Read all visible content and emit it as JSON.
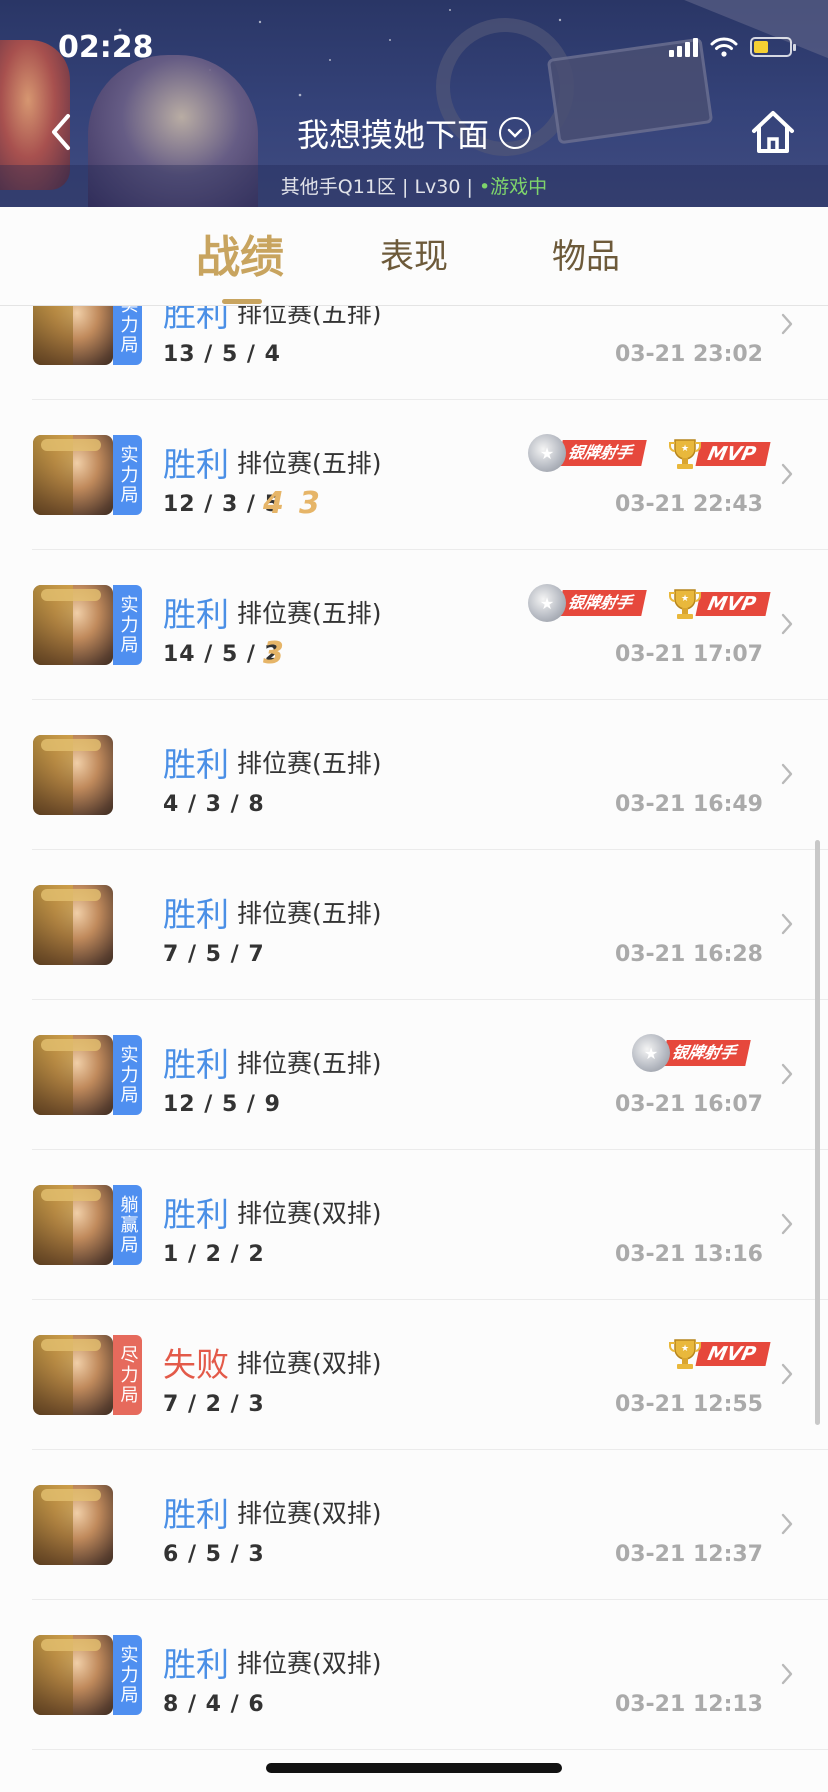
{
  "status": {
    "time": "02:28"
  },
  "header": {
    "nickname": "我想摸她下面",
    "server": "其他手Q11区",
    "level": "Lv30",
    "online_status": "游戏中"
  },
  "tabs": [
    {
      "label": "战绩",
      "active": true
    },
    {
      "label": "表现",
      "active": false
    },
    {
      "label": "物品",
      "active": false
    }
  ],
  "matches": [
    {
      "tag": "实力局",
      "tag_color": "blue",
      "result": "胜利",
      "result_type": "win",
      "mode": "排位赛(五排)",
      "kda": "13 / 5 / 4",
      "datetime": "03-21 23:02",
      "multikills": [],
      "silver_badge": "",
      "mvp": ""
    },
    {
      "tag": "实力局",
      "tag_color": "blue",
      "result": "胜利",
      "result_type": "win",
      "mode": "排位赛(五排)",
      "kda": "12 / 3 / 5",
      "datetime": "03-21 22:43",
      "multikills": [
        "4",
        "3"
      ],
      "silver_badge": "银牌射手",
      "mvp": "MVP"
    },
    {
      "tag": "实力局",
      "tag_color": "blue",
      "result": "胜利",
      "result_type": "win",
      "mode": "排位赛(五排)",
      "kda": "14 / 5 / 2",
      "datetime": "03-21 17:07",
      "multikills": [
        "3"
      ],
      "silver_badge": "银牌射手",
      "mvp": "MVP"
    },
    {
      "tag": "",
      "tag_color": "",
      "result": "胜利",
      "result_type": "win",
      "mode": "排位赛(五排)",
      "kda": "4 / 3 / 8",
      "datetime": "03-21 16:49",
      "multikills": [],
      "silver_badge": "",
      "mvp": ""
    },
    {
      "tag": "",
      "tag_color": "",
      "result": "胜利",
      "result_type": "win",
      "mode": "排位赛(五排)",
      "kda": "7 / 5 / 7",
      "datetime": "03-21 16:28",
      "multikills": [],
      "silver_badge": "",
      "mvp": ""
    },
    {
      "tag": "实力局",
      "tag_color": "blue",
      "result": "胜利",
      "result_type": "win",
      "mode": "排位赛(五排)",
      "kda": "12 / 5 / 9",
      "datetime": "03-21 16:07",
      "multikills": [],
      "silver_badge": "银牌射手",
      "mvp": ""
    },
    {
      "tag": "躺赢局",
      "tag_color": "blue",
      "result": "胜利",
      "result_type": "win",
      "mode": "排位赛(双排)",
      "kda": "1 / 2 / 2",
      "datetime": "03-21 13:16",
      "multikills": [],
      "silver_badge": "",
      "mvp": ""
    },
    {
      "tag": "尽力局",
      "tag_color": "red",
      "result": "失败",
      "result_type": "lose",
      "mode": "排位赛(双排)",
      "kda": "7 / 2 / 3",
      "datetime": "03-21 12:55",
      "multikills": [],
      "silver_badge": "",
      "mvp": "MVP"
    },
    {
      "tag": "",
      "tag_color": "",
      "result": "胜利",
      "result_type": "win",
      "mode": "排位赛(双排)",
      "kda": "6 / 5 / 3",
      "datetime": "03-21 12:37",
      "multikills": [],
      "silver_badge": "",
      "mvp": ""
    },
    {
      "tag": "实力局",
      "tag_color": "blue",
      "result": "胜利",
      "result_type": "win",
      "mode": "排位赛(双排)",
      "kda": "8 / 4 / 6",
      "datetime": "03-21 12:13",
      "multikills": [],
      "silver_badge": "",
      "mvp": ""
    }
  ],
  "colors": {
    "win": "#4a8fe6",
    "lose": "#e35a49",
    "accent_gold": "#c8a45f"
  }
}
